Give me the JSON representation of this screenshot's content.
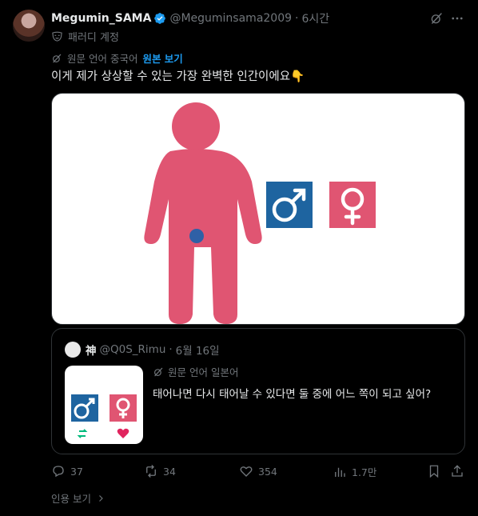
{
  "author": {
    "name": "Megumin_SAMA",
    "handle": "@Meguminsama2009",
    "time": "6시간",
    "separator": "·",
    "parody_label": "패러디 계정"
  },
  "translation": {
    "original_language": "원문 언어 중국어",
    "view_original": "원본 보기"
  },
  "tweet": {
    "text": "이게 제가 상상할 수 있는 가장 완벽한 인간이에요👇"
  },
  "quote": {
    "name": "神",
    "handle": "@Q0S_Rimu",
    "separator": "·",
    "date": "6월 16일",
    "original_language": "원문 언어 일본어",
    "text": "태어나면 다시 태어날 수 있다면 둘 중에 어느 쪽이 되고 싶어?"
  },
  "actions": {
    "replies": "37",
    "reposts": "34",
    "likes": "354",
    "views": "1.7만"
  },
  "footer": {
    "view_quotes": "인용 보기"
  },
  "colors": {
    "background": "#000000",
    "text": "#e7e9ea",
    "muted": "#71767b",
    "accent": "#1d9bf0",
    "figure_pink": "#e05572",
    "male_blue": "#1e64a0",
    "border": "#2f3336"
  },
  "icons": {
    "verified": "verified-badge-icon",
    "grok": "grok-icon",
    "more": "more-dots-icon",
    "parody": "parody-mask-icon",
    "translate": "translate-icon",
    "reply": "reply-icon",
    "repost": "repost-icon",
    "like": "like-icon",
    "views": "views-icon",
    "bookmark": "bookmark-icon",
    "share": "share-icon",
    "chevron": "chevron-right-icon"
  }
}
